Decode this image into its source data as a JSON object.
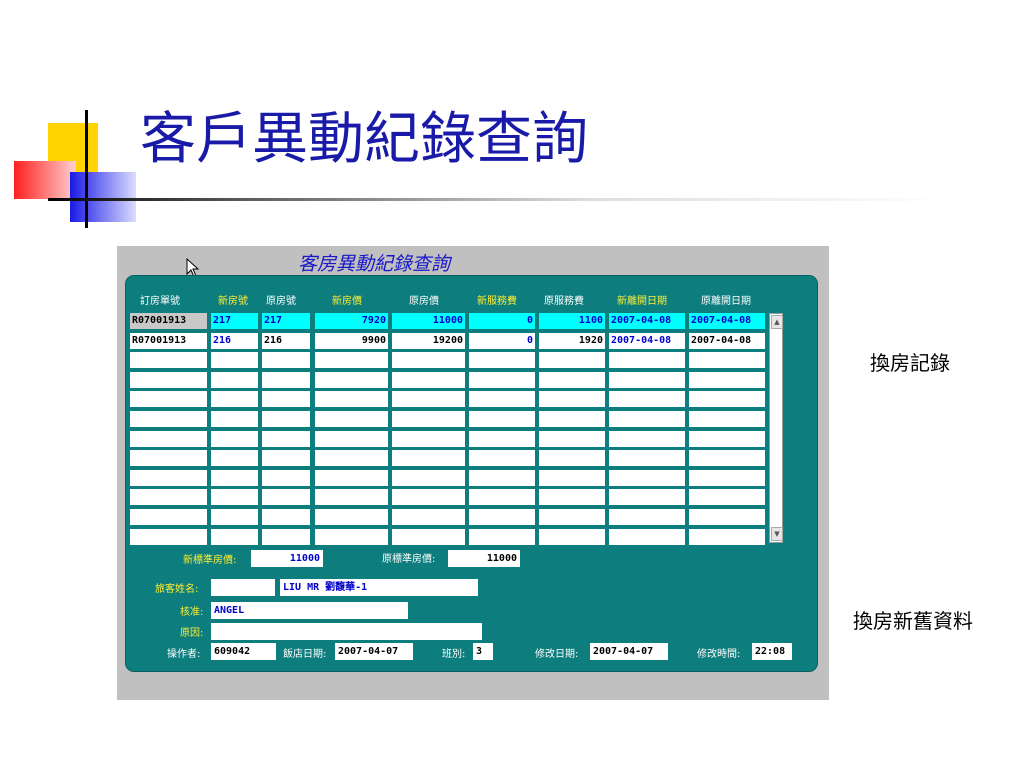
{
  "slide": {
    "title": "客戶異動紀錄查詢",
    "side_labels": [
      "換房記錄",
      "換房新舊資料"
    ]
  },
  "form": {
    "title": "客房異動紀錄查詢",
    "columns": [
      "訂房單號",
      "新房號",
      "原房號",
      "新房價",
      "原房價",
      "新服務費",
      "原服務費",
      "新離開日期",
      "原離開日期"
    ],
    "rows": [
      [
        "R07001913",
        "217",
        "217",
        "7920",
        "11000",
        "0",
        "1100",
        "2007-04-08",
        "2007-04-08"
      ],
      [
        "R07001913",
        "216",
        "216",
        "9900",
        "19200",
        "0",
        "1920",
        "2007-04-08",
        "2007-04-08"
      ]
    ],
    "new_std_price_label": "新標準房價:",
    "new_std_price": "11000",
    "old_std_price_label": "原標準房價:",
    "old_std_price": "11000",
    "guest_name_label": "旅客姓名:",
    "guest_code": "",
    "guest_name": "LIU MR 劉馥華-1",
    "approver_label": "核准:",
    "approver": "ANGEL",
    "reason_label": "原因:",
    "reason": "",
    "operator_label": "操作者:",
    "operator": "609042",
    "hotel_date_label": "飯店日期:",
    "hotel_date": "2007-04-07",
    "shift_label": "班別:",
    "shift": "3",
    "modify_date_label": "修改日期:",
    "modify_date": "2007-04-07",
    "modify_time_label": "修改時間:",
    "modify_time": "22:08"
  },
  "colors": {
    "panel": "#0d7d7d",
    "highlight": "#00ffff",
    "title_blue": "#1a1aa8",
    "header_yellow": "#ffee33"
  },
  "icons": [
    "mouse-cursor-icon",
    "scroll-up-icon",
    "scroll-down-icon"
  ]
}
